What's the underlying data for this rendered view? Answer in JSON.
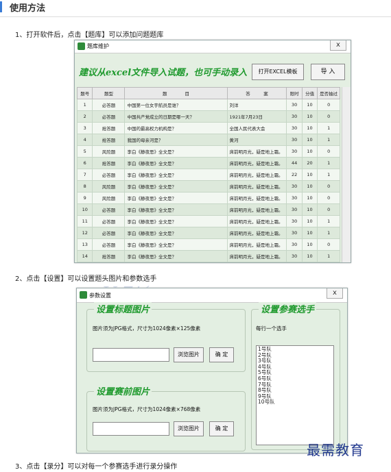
{
  "header": {
    "title": "使用方法",
    "accent": "#3a7bd5"
  },
  "steps": [
    "1、打开软件后，点击【题库】可以添加问题题库",
    "2、点击【设置】可以设置题头图片和参数选手",
    "3、点击【录分】可以对每一个参赛选手进行录分操作"
  ],
  "win1": {
    "title": "题库维护",
    "close": "x",
    "slogan": "建议从excel文件导入试题，也可手动录入",
    "open_template_button": "打开EXCEL模板",
    "import_button": "导 入",
    "columns": [
      "题号",
      "题型",
      "题　　　　目",
      "答　　　案",
      "限时",
      "分值",
      "是否抽过"
    ],
    "rows": [
      [
        "1",
        "必答题",
        "中国第一位女宇航员是谁？",
        "刘洋",
        "30",
        "10",
        "0"
      ],
      [
        "2",
        "必答题",
        "中国共产党成立的日期是哪一天？",
        "1921年7月23日",
        "30",
        "10",
        "0"
      ],
      [
        "3",
        "抢答题",
        "中国的最高权力机构是？",
        "全国人民代表大会",
        "30",
        "10",
        "1"
      ],
      [
        "4",
        "抢答题",
        "我国的母亲河是？",
        "黄河",
        "30",
        "10",
        "1"
      ],
      [
        "5",
        "风险题",
        "李白《静夜思》全文是？",
        "床前明月光，疑是地上霜。",
        "30",
        "10",
        "0"
      ],
      [
        "6",
        "抢答题",
        "李白《静夜思》全文是？",
        "床前明月光，疑是地上霜。",
        "44",
        "20",
        "1"
      ],
      [
        "7",
        "必答题",
        "李白《静夜思》全文是？",
        "床前明月光，疑是地上霜。",
        "22",
        "10",
        "1"
      ],
      [
        "8",
        "风险题",
        "李白《静夜思》全文是？",
        "床前明月光，疑是地上霜。",
        "30",
        "10",
        "0"
      ],
      [
        "9",
        "风险题",
        "李白《静夜思》全文是？",
        "床前明月光，疑是地上霜。",
        "30",
        "10",
        "0"
      ],
      [
        "10",
        "必答题",
        "李白《静夜思》全文是？",
        "床前明月光，疑是地上霜。",
        "30",
        "10",
        "0"
      ],
      [
        "11",
        "必答题",
        "李白《静夜思》全文是？",
        "床前明月光，疑是地上霜。",
        "30",
        "10",
        "1"
      ],
      [
        "12",
        "必答题",
        "李白《静夜思》全文是？",
        "床前明月光，疑是地上霜。",
        "30",
        "10",
        "1"
      ],
      [
        "13",
        "必答题",
        "李白《静夜思》全文是？",
        "床前明月光，疑是地上霜。",
        "30",
        "10",
        "0"
      ],
      [
        "14",
        "抢答题",
        "李白《静夜思》全文是？",
        "床前明月光，疑是地上霜。",
        "30",
        "10",
        "1"
      ]
    ]
  },
  "win2": {
    "title": "参数设置",
    "close": "x",
    "group_title_image": {
      "title": "设置标题图片",
      "hint": "图片须为JPG格式，尺寸为1024像素×125像素",
      "browse": "浏览图片",
      "ok": "确 定"
    },
    "group_pre_image": {
      "title": "设置赛前图片",
      "hint": "图片须为JPG格式，尺寸为1024像素×768像素",
      "browse": "浏览图片",
      "ok": "确 定"
    },
    "group_players": {
      "title": "设置参赛选手",
      "hint": "每行一个选手",
      "players": [
        "1号队",
        "2号队",
        "3号队",
        "4号队",
        "5号队",
        "6号队",
        "7号队",
        "8号队",
        "9号队",
        "10号队"
      ]
    }
  },
  "watermark": "最需教育"
}
